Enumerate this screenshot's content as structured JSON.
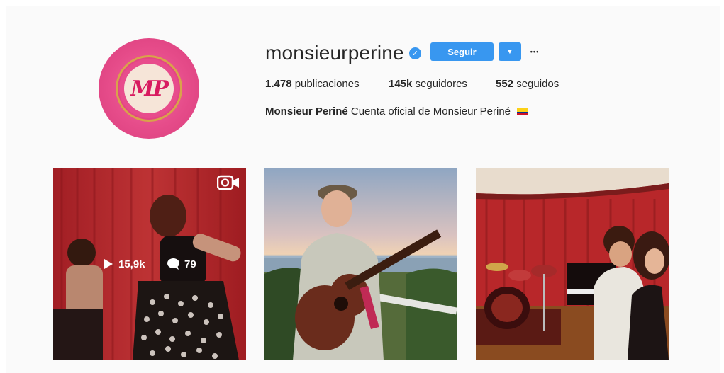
{
  "profile": {
    "username": "monsieurperine",
    "avatar_monogram": "MP",
    "follow_label": "Seguir",
    "dropdown_glyph": "▼",
    "more_glyph": "•••",
    "verified_glyph": "✓"
  },
  "stats": {
    "posts_count": "1.478",
    "posts_label": "publicaciones",
    "followers_count": "145k",
    "followers_label": "seguidores",
    "following_count": "552",
    "following_label": "seguidos"
  },
  "bio": {
    "name": "Monsieur Periné",
    "text": "Cuenta oficial de Monsieur Periné"
  },
  "posts": [
    {
      "type": "video",
      "views": "15,9k",
      "comments": "79",
      "hovered": true
    },
    {
      "type": "image"
    },
    {
      "type": "image"
    }
  ],
  "colors": {
    "accent": "#3897f0",
    "background": "#fafafa",
    "avatar_pink": "#e64c8a"
  }
}
